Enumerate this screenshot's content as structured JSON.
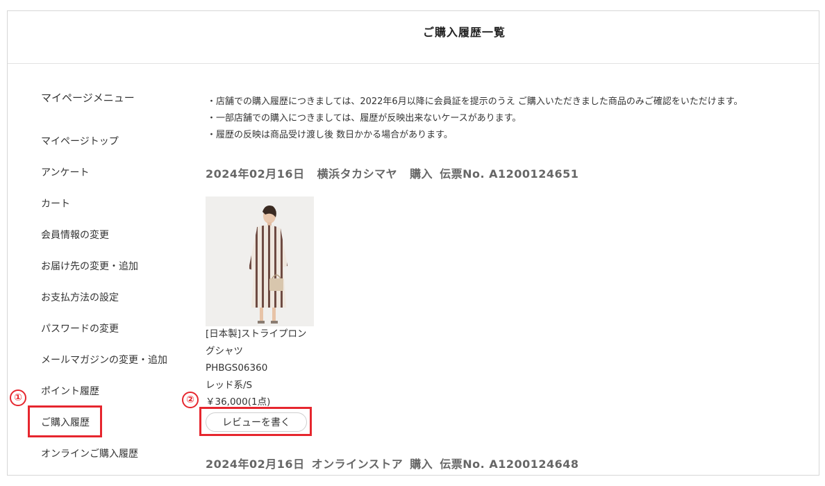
{
  "page_title": "ご購入履歴一覧",
  "menu": {
    "heading": "マイページメニュー",
    "items": [
      "マイページトップ",
      "アンケート",
      "カート",
      "会員情報の変更",
      "お届け先の変更・追加",
      "お支払方法の設定",
      "パスワードの変更",
      "メールマガジンの変更・追加",
      "ポイント履歴",
      "ご購入履歴",
      "オンラインご購入履歴"
    ]
  },
  "notes": [
    "・店舗での購入履歴につきましては、2022年6月以降に会員証を提示のうえ ご購入いただきました商品のみご確認をいただけます。",
    "・一部店舗での購入につきましては、履歴が反映出来ないケースがあります。",
    "・履歴の反映は商品受け渡し後 数日かかる場合があります。"
  ],
  "orders": [
    {
      "date": "2024年02月16日",
      "store": "横浜タカシマヤ",
      "type": "購入",
      "slip": "伝票No. A1200124651",
      "product": {
        "name_line1": "[日本製]ストライプロン",
        "name_line2": "グシャツ",
        "code": "PHBGS06360",
        "color_size": "レッド系/S",
        "price": "￥36,000(1点)",
        "review_label": "レビューを書く"
      }
    },
    {
      "date": "2024年02月16日",
      "store": "オンラインストア",
      "type": "購入",
      "slip": "伝票No. A1200124648"
    }
  ],
  "annotations": {
    "step1": "①",
    "step2": "②",
    "color": "#e6262e"
  }
}
